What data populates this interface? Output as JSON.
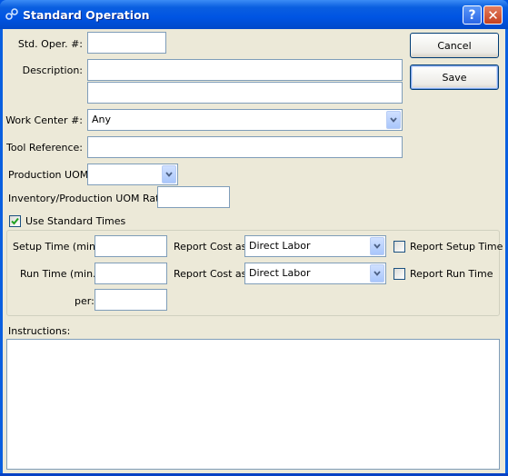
{
  "window": {
    "title": "Standard Operation",
    "help_label": "?",
    "close_label": "✕"
  },
  "form": {
    "std_oper_label": "Std. Oper. #:",
    "std_oper_value": "",
    "description_label": "Description:",
    "description_line1": "",
    "description_line2": "",
    "work_center_label": "Work Center #:",
    "work_center_value": "Any",
    "tool_reference_label": "Tool Reference:",
    "tool_reference_value": "",
    "production_uom_label": "Production UOM:",
    "production_uom_value": "",
    "uom_ratio_label": "Inventory/Production UOM Ratio:",
    "uom_ratio_value": "",
    "use_standard_times_label": "Use Standard Times",
    "use_standard_times_checked": true
  },
  "standard_times": {
    "setup_time_label": "Setup Time (min.):",
    "setup_time_value": "",
    "setup_report_cost_label": "Report Cost as:",
    "setup_report_cost_value": "Direct Labor",
    "report_setup_time_label": "Report Setup Time",
    "report_setup_time_checked": false,
    "run_time_label": "Run Time (min.):",
    "run_time_value": "",
    "run_report_cost_label": "Report Cost as:",
    "run_report_cost_value": "Direct Labor",
    "report_run_time_label": "Report Run Time",
    "report_run_time_checked": false,
    "per_label": "per:",
    "per_value": ""
  },
  "instructions": {
    "label": "Instructions:",
    "value": ""
  },
  "buttons": {
    "cancel_label": "Cancel",
    "save_label": "Save"
  },
  "colors": {
    "titlebar": "#0054e3",
    "dialog_bg": "#ece9d8",
    "input_border": "#7f9db9",
    "check_green": "#21a121"
  }
}
